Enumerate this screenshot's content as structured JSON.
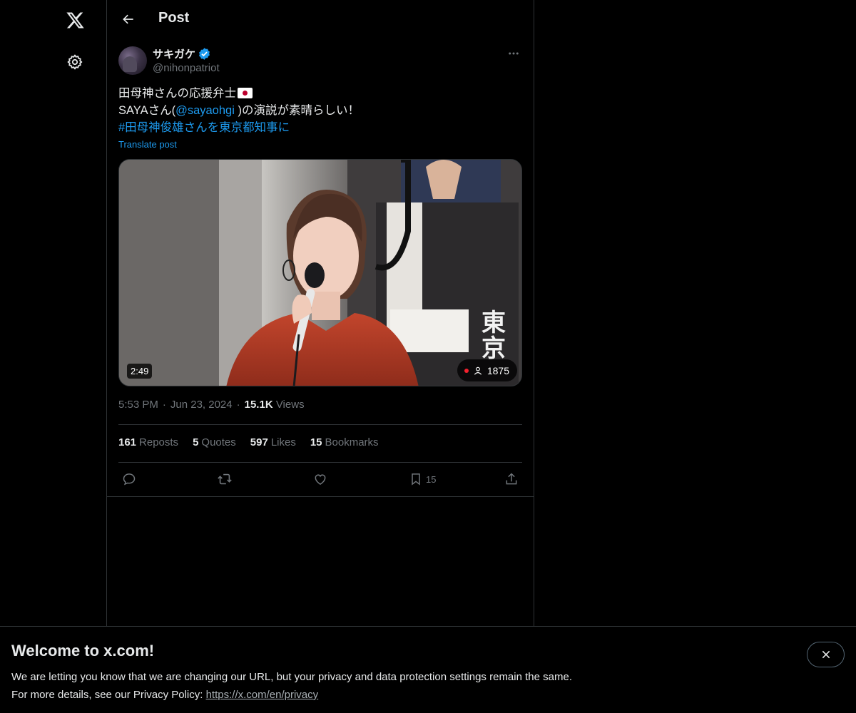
{
  "nav": {
    "logo_icon": "x-logo-icon",
    "settings_icon": "gear-icon"
  },
  "header": {
    "title": "Post",
    "back_icon": "arrow-left-icon"
  },
  "post": {
    "author": {
      "name": "サキガケ",
      "handle": "@nihonpatriot",
      "verified": true
    },
    "text": {
      "line1": "田母神さんの応援弁士",
      "line2_prefix": "SAYAさん(",
      "line2_mention": "@sayaohgi",
      "line2_suffix": " )の演説が素晴らしい！",
      "hashtag": "#田母神俊雄さんを東京都知事に"
    },
    "translate_label": "Translate post",
    "media": {
      "duration": "2:49",
      "viewers": "1875",
      "overlay_text_1": "東",
      "overlay_text_2": "京"
    },
    "meta": {
      "time": "5:53 PM",
      "date": "Jun 23, 2024",
      "views_count": "15.1K",
      "views_label": "Views",
      "separator": "·"
    },
    "stats": {
      "reposts_count": "161",
      "reposts_label": "Reposts",
      "quotes_count": "5",
      "quotes_label": "Quotes",
      "likes_count": "597",
      "likes_label": "Likes",
      "bookmarks_count": "15",
      "bookmarks_label": "Bookmarks"
    },
    "actions": {
      "bookmark_count": "15"
    }
  },
  "banner": {
    "title": "Welcome to x.com!",
    "line1": "We are letting you know that we are changing our URL, but your privacy and data protection settings remain the same.",
    "line2_prefix": "For more details, see our Privacy Policy: ",
    "link": "https://x.com/en/privacy"
  },
  "colors": {
    "background": "#000000",
    "text": "#e7e9ea",
    "muted": "#71767b",
    "accent": "#1d9bf0",
    "border": "#2f3336",
    "live": "#f4212e"
  }
}
